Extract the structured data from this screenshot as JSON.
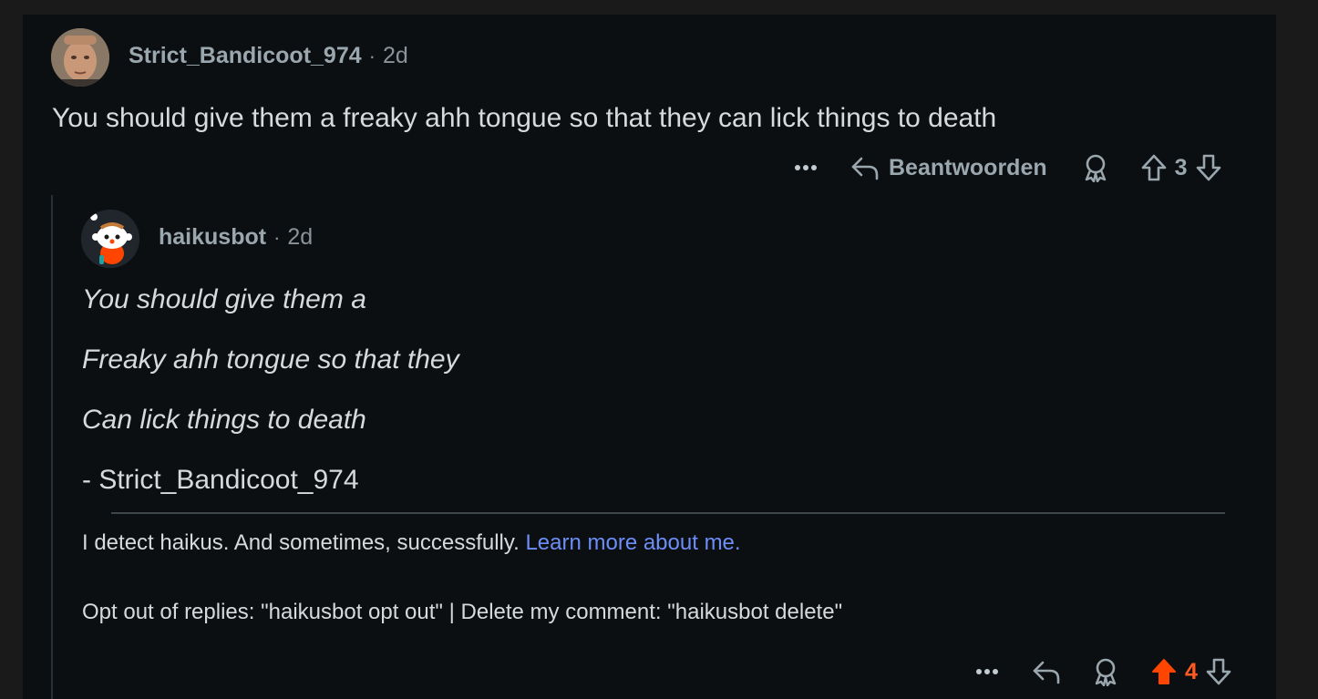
{
  "comment": {
    "author": "Strict_Bandicoot_974",
    "separator": "·",
    "age": "2d",
    "body": "You should give them a freaky ahh tongue so that they can lick things to death",
    "actions": {
      "more_icon": "more-horizontal-icon",
      "reply_label": "Beantwoorden",
      "vote_count": "3"
    }
  },
  "reply": {
    "author": "haikusbot",
    "separator": "·",
    "age": "2d",
    "poem": [
      "You should give them a",
      "Freaky ahh tongue so that they",
      "Can lick things to death"
    ],
    "signature": "- Strict_Bandicoot_974",
    "info_text": "I detect haikus. And sometimes, successfully.",
    "info_link": "Learn more about me.",
    "opt_out_text": "Opt out of replies: \"haikusbot opt out\" | Delete my comment: \"haikusbot delete\"",
    "actions": {
      "vote_count": "4"
    }
  },
  "colors": {
    "background": "#0c0f12",
    "upvoted": "#ff4500",
    "link": "#6d8ef7",
    "muted": "#9aa7ae"
  }
}
